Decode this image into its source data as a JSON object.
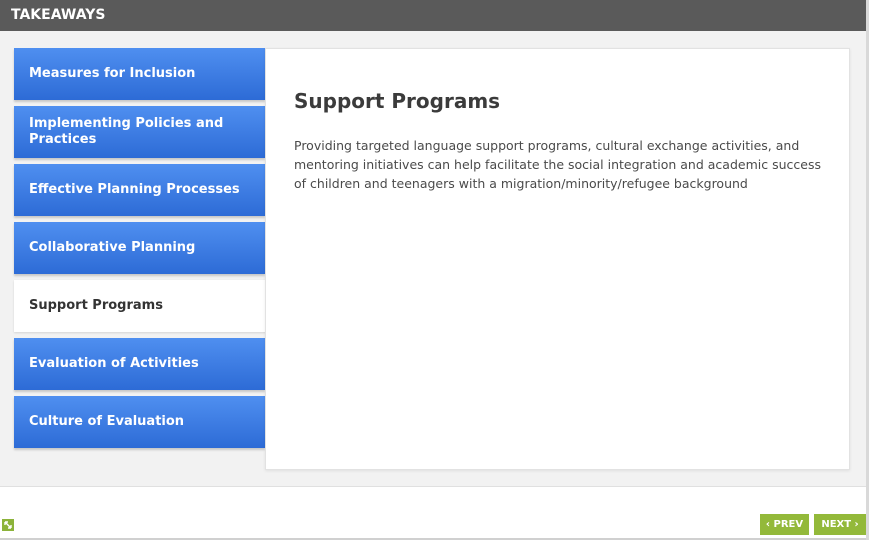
{
  "header": {
    "title": "TAKEAWAYS"
  },
  "tabs": [
    {
      "label": "Measures for Inclusion"
    },
    {
      "label": "Implementing Policies and Practices"
    },
    {
      "label": "Effective Planning Processes"
    },
    {
      "label": "Collaborative Planning"
    },
    {
      "label": "Support Programs"
    },
    {
      "label": "Evaluation of Activities"
    },
    {
      "label": "Culture of Evaluation"
    }
  ],
  "content": {
    "title": "Support Programs",
    "body": "Providing targeted language support programs, cultural exchange activities, and mentoring initiatives can help facilitate the social integration and academic success of children and teenagers with a migration/minority/refugee background"
  },
  "nav": {
    "prev_label": "PREV",
    "next_label": "NEXT"
  },
  "icons": {
    "resize": "expand-icon",
    "prev": "chevron-left-icon",
    "next": "chevron-right-icon"
  },
  "colors": {
    "tab_blue": "#2d6bd6",
    "header_gray": "#5a5a5a",
    "nav_green": "#93b93a"
  }
}
